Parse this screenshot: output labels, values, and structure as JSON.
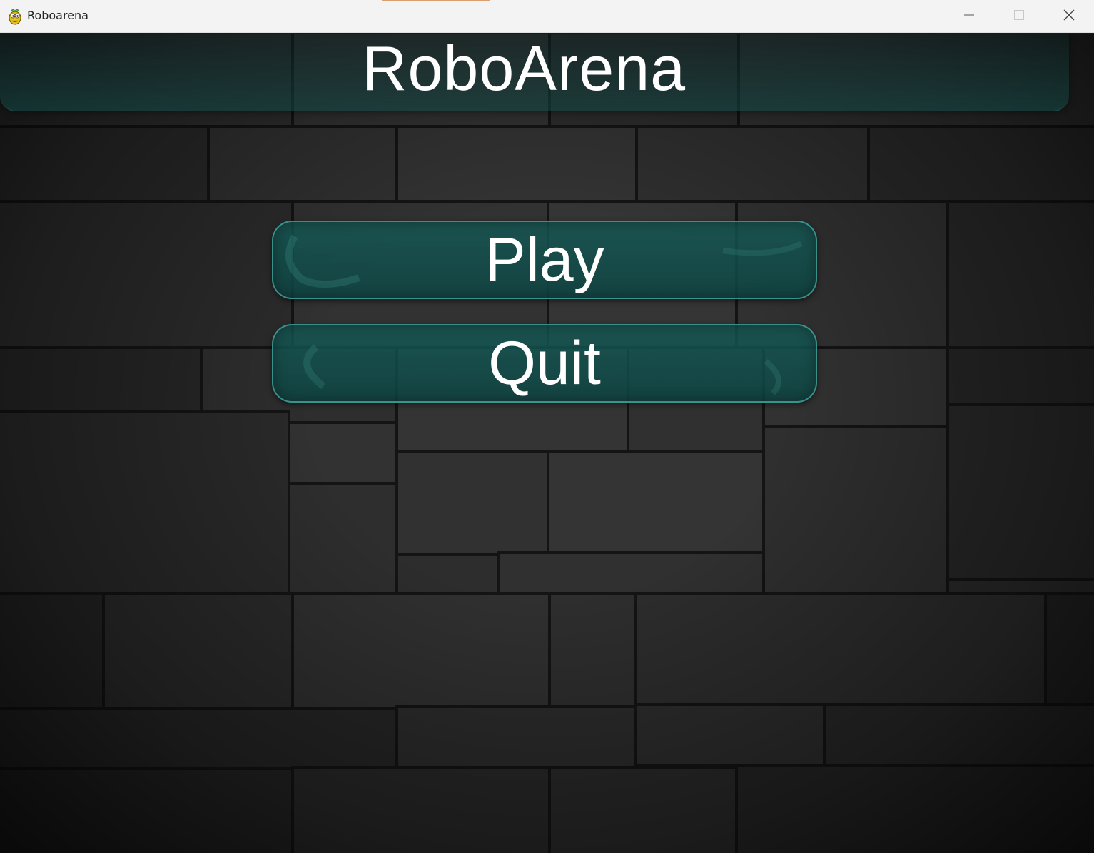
{
  "window": {
    "title": "Roboarena",
    "app_icon": "pygame-snake-icon",
    "controls": [
      "minimize-icon",
      "maximize-icon",
      "close-icon"
    ]
  },
  "game": {
    "title": "RoboArena",
    "menu": {
      "play_label": "Play",
      "quit_label": "Quit"
    }
  },
  "colors": {
    "button_fill": "#12524f",
    "button_border": "#46aaa0",
    "banner": "#124b48",
    "wall": "#2a2a2a",
    "text": "#ffffff"
  }
}
